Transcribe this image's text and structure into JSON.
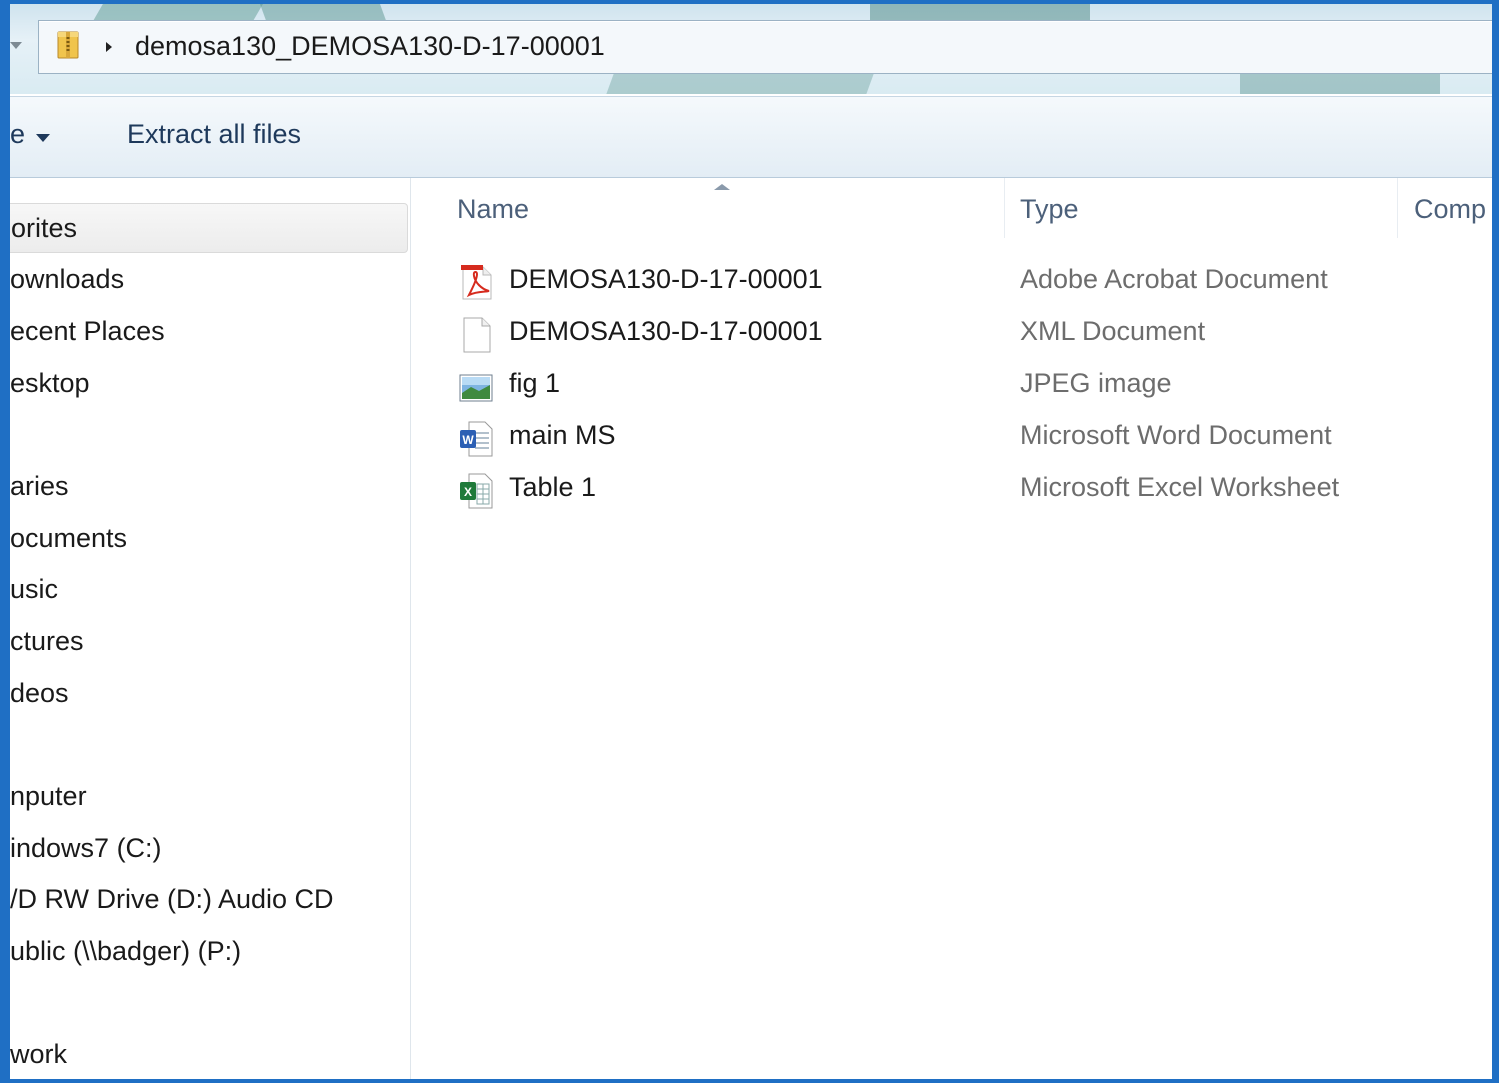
{
  "address": {
    "path": "demosa130_DEMOSA130-D-17-00001"
  },
  "commandbar": {
    "organize_partial": "e",
    "extract_label": "Extract all files"
  },
  "nav": {
    "items": [
      {
        "label": "orites",
        "selected": true
      },
      {
        "label": "ownloads"
      },
      {
        "label": "ecent Places"
      },
      {
        "label": "esktop"
      },
      {
        "label": "aries"
      },
      {
        "label": "ocuments"
      },
      {
        "label": "usic"
      },
      {
        "label": "ctures"
      },
      {
        "label": "deos"
      },
      {
        "label": "nputer"
      },
      {
        "label": "indows7 (C:)"
      },
      {
        "label": "/D RW Drive (D:) Audio CD"
      },
      {
        "label": "ublic (\\\\badger) (P:)"
      },
      {
        "label": "work"
      }
    ]
  },
  "columns": {
    "name": "Name",
    "type": "Type",
    "compressed": "Comp"
  },
  "files": [
    {
      "name": "DEMOSA130-D-17-00001",
      "type": "Adobe Acrobat Document",
      "icon": "pdf-icon"
    },
    {
      "name": "DEMOSA130-D-17-00001",
      "type": "XML Document",
      "icon": "xml-file-icon"
    },
    {
      "name": "fig 1",
      "type": "JPEG image",
      "icon": "jpeg-image-icon"
    },
    {
      "name": "main MS",
      "type": "Microsoft Word Document",
      "icon": "word-document-icon"
    },
    {
      "name": "Table 1",
      "type": "Microsoft Excel Worksheet",
      "icon": "excel-worksheet-icon"
    }
  ]
}
